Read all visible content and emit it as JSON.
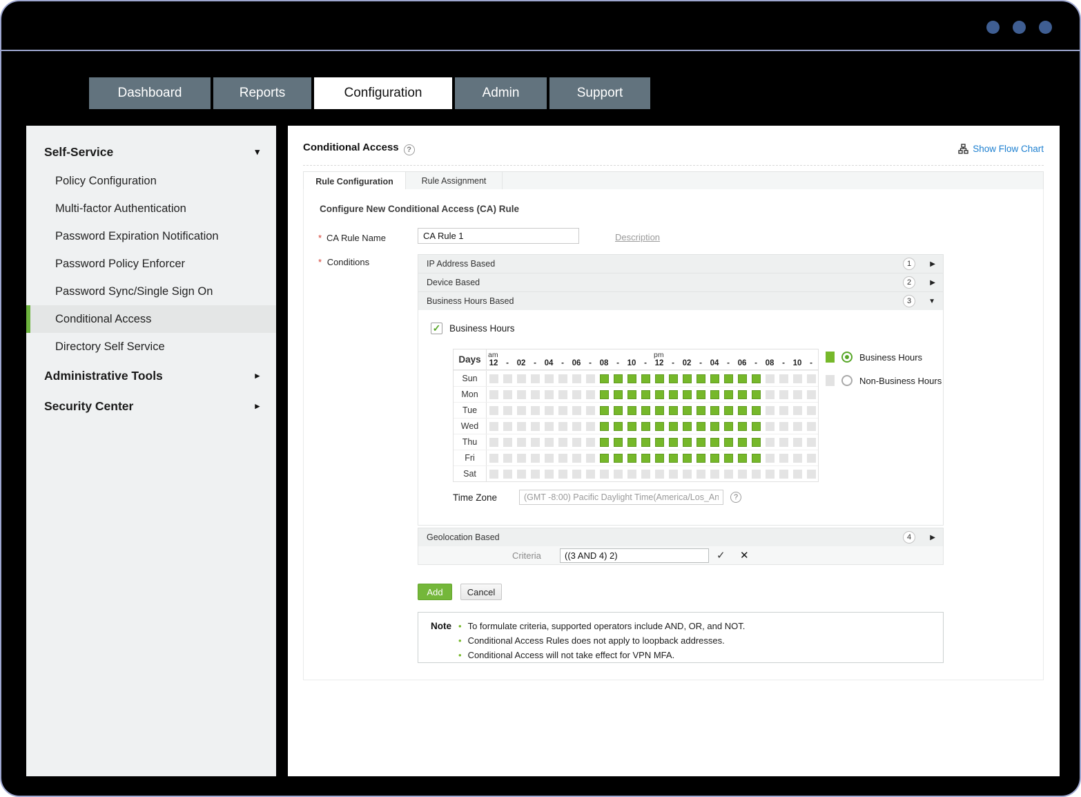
{
  "window": {
    "dot_count": 3,
    "dot_color": "#3f5e92",
    "frame_color": "#9ea7d0"
  },
  "nav": {
    "tabs": [
      {
        "label": "Dashboard",
        "active": false
      },
      {
        "label": "Reports",
        "active": false
      },
      {
        "label": "Configuration",
        "active": true
      },
      {
        "label": "Admin",
        "active": false
      },
      {
        "label": "Support",
        "active": false
      }
    ]
  },
  "sidebar": {
    "sections": [
      {
        "label": "Self-Service",
        "expanded": true
      },
      {
        "label": "Administrative Tools",
        "expanded": false
      },
      {
        "label": "Security Center",
        "expanded": false
      }
    ],
    "items": [
      {
        "label": "Policy Configuration",
        "selected": false
      },
      {
        "label": "Multi-factor Authentication",
        "selected": false
      },
      {
        "label": "Password Expiration Notification",
        "selected": false
      },
      {
        "label": "Password Policy Enforcer",
        "selected": false
      },
      {
        "label": "Password Sync/Single Sign On",
        "selected": false
      },
      {
        "label": "Conditional Access",
        "selected": true
      },
      {
        "label": "Directory Self Service",
        "selected": false
      }
    ]
  },
  "main": {
    "title": "Conditional Access",
    "help_icon": "?",
    "flow_link": "Show Flow Chart",
    "tabs": [
      {
        "label": "Rule Configuration",
        "active": true
      },
      {
        "label": "Rule Assignment",
        "active": false
      }
    ],
    "form": {
      "heading": "Configure New Conditional Access (CA) Rule",
      "required_mark": "*",
      "ca_rule_name": {
        "label": "CA Rule Name",
        "value": "CA Rule 1"
      },
      "description_link": "Description",
      "conditions_label": "Conditions",
      "accordions": [
        {
          "label": "IP Address Based",
          "number": "1",
          "expanded": false
        },
        {
          "label": "Device Based",
          "number": "2",
          "expanded": false
        },
        {
          "label": "Business Hours Based",
          "number": "3",
          "expanded": true
        },
        {
          "label": "Geolocation Based",
          "number": "4",
          "expanded": false
        }
      ],
      "business_hours": {
        "checkbox_label": "Business Hours",
        "checkbox_checked": true,
        "days_header": "Days",
        "am_label": "am",
        "pm_label": "pm",
        "hour_labels": [
          "12",
          "-",
          "02",
          "-",
          "04",
          "-",
          "06",
          "-",
          "08",
          "-",
          "10",
          "-",
          "12",
          "-",
          "02",
          "-",
          "04",
          "-",
          "06",
          "-",
          "08",
          "-",
          "10",
          "-"
        ],
        "days": [
          "Sun",
          "Mon",
          "Tue",
          "Wed",
          "Thu",
          "Fri",
          "Sat"
        ],
        "schedule": [
          [
            0,
            0,
            0,
            0,
            0,
            0,
            0,
            0,
            1,
            1,
            1,
            1,
            1,
            1,
            1,
            1,
            1,
            1,
            1,
            1,
            0,
            0,
            0,
            0
          ],
          [
            0,
            0,
            0,
            0,
            0,
            0,
            0,
            0,
            1,
            1,
            1,
            1,
            1,
            1,
            1,
            1,
            1,
            1,
            1,
            1,
            0,
            0,
            0,
            0
          ],
          [
            0,
            0,
            0,
            0,
            0,
            0,
            0,
            0,
            1,
            1,
            1,
            1,
            1,
            1,
            1,
            1,
            1,
            1,
            1,
            1,
            0,
            0,
            0,
            0
          ],
          [
            0,
            0,
            0,
            0,
            0,
            0,
            0,
            0,
            1,
            1,
            1,
            1,
            1,
            1,
            1,
            1,
            1,
            1,
            1,
            1,
            0,
            0,
            0,
            0
          ],
          [
            0,
            0,
            0,
            0,
            0,
            0,
            0,
            0,
            1,
            1,
            1,
            1,
            1,
            1,
            1,
            1,
            1,
            1,
            1,
            1,
            0,
            0,
            0,
            0
          ],
          [
            0,
            0,
            0,
            0,
            0,
            0,
            0,
            0,
            1,
            1,
            1,
            1,
            1,
            1,
            1,
            1,
            1,
            1,
            1,
            1,
            0,
            0,
            0,
            0
          ],
          [
            0,
            0,
            0,
            0,
            0,
            0,
            0,
            0,
            0,
            0,
            0,
            0,
            0,
            0,
            0,
            0,
            0,
            0,
            0,
            0,
            0,
            0,
            0,
            0
          ]
        ],
        "on_color": "#76b82a",
        "off_color": "#e4e4e4",
        "legend": [
          {
            "label": "Business Hours",
            "selected": true
          },
          {
            "label": "Non-Business Hours",
            "selected": false
          }
        ],
        "time_zone": {
          "label": "Time Zone",
          "value": "(GMT -8:00) Pacific Daylight Time(America/Los_An"
        }
      },
      "criteria": {
        "label": "Criteria",
        "value": "((3 AND 4) 2)",
        "confirm_icon": "✓",
        "cancel_icon": "✕"
      },
      "buttons": {
        "add": "Add",
        "cancel": "Cancel"
      },
      "note": {
        "label": "Note",
        "items": [
          "To formulate criteria, supported operators include AND, OR, and NOT.",
          "Conditional Access Rules does not apply to loopback addresses.",
          "Conditional Access will not take effect for VPN MFA."
        ]
      }
    }
  }
}
